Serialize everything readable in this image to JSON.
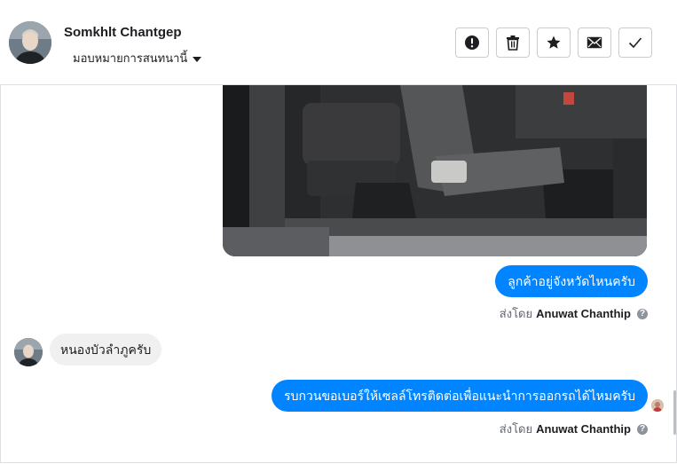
{
  "header": {
    "contact_name": "Somkhlt Chantgep",
    "assign_label": "มอบหมายการสนทนานี้",
    "actions": [
      {
        "name": "spam",
        "icon": "exclamation-circle-icon"
      },
      {
        "name": "delete",
        "icon": "trash-icon"
      },
      {
        "name": "star",
        "icon": "star-icon"
      },
      {
        "name": "mark-unread",
        "icon": "envelope-icon"
      },
      {
        "name": "done",
        "icon": "check-icon"
      }
    ]
  },
  "messages": [
    {
      "direction": "outgoing",
      "type": "image",
      "content": "car-interior-photo"
    },
    {
      "direction": "outgoing",
      "type": "text",
      "text": "ลูกค้าอยู่จังหวัดไหนครับ"
    },
    {
      "sent_by_prefix": "ส่งโดย",
      "sent_by_name": "Anuwat Chanthip"
    },
    {
      "direction": "incoming",
      "type": "text",
      "text": "หนองบัวลำภูครับ"
    },
    {
      "direction": "outgoing",
      "type": "text",
      "text": "รบกวนขอเบอร์ให้เซลล์โทรติดต่อเพื่อแนะนำการออกรถได้ไหมครับ"
    },
    {
      "sent_by_prefix": "ส่งโดย",
      "sent_by_name": "Anuwat Chanthip"
    }
  ],
  "colors": {
    "outgoing_bubble": "#0084ff",
    "incoming_bubble": "#f0f0f0",
    "secondary_text": "#606770"
  }
}
